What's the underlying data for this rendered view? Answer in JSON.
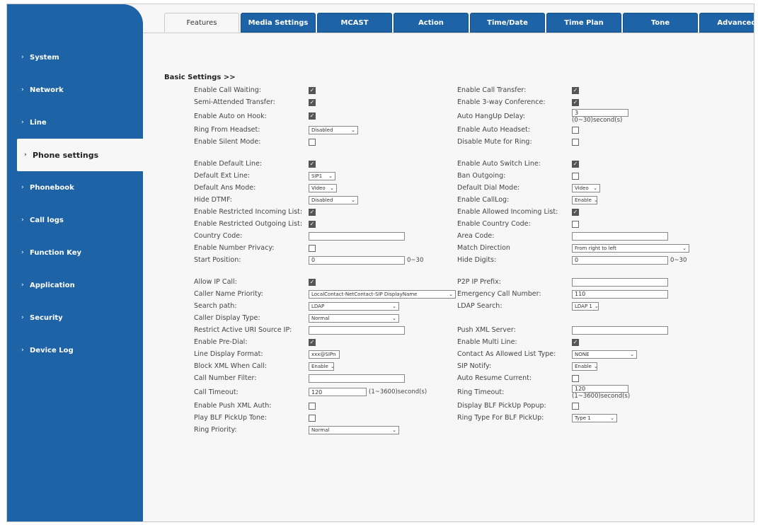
{
  "sidebar": {
    "items": [
      {
        "label": "System"
      },
      {
        "label": "Network"
      },
      {
        "label": "Line"
      },
      {
        "label": "Phone settings"
      },
      {
        "label": "Phonebook"
      },
      {
        "label": "Call logs"
      },
      {
        "label": "Function Key"
      },
      {
        "label": "Application"
      },
      {
        "label": "Security"
      },
      {
        "label": "Device Log"
      }
    ],
    "active_index": 3
  },
  "tabs": [
    "Features",
    "Media Settings",
    "MCAST",
    "Action",
    "Time/Date",
    "Time Plan",
    "Tone",
    "Advanced"
  ],
  "section": {
    "title": "Basic Settings >>"
  },
  "rows": [
    {
      "l": "Enable Call Waiting:",
      "r": "Enable Call Transfer:"
    },
    {
      "l": "Semi-Attended Transfer:",
      "r": "Enable 3-way Conference:"
    },
    {
      "l": "Enable Auto on Hook:",
      "r": "Auto HangUp Delay:",
      "r_val": "3",
      "r_unit": "(0~30)second(s)"
    },
    {
      "l": "Ring From Headset:",
      "l_sel": "Disabled",
      "r": "Enable Auto Headset:"
    },
    {
      "l": "Enable Silent Mode:",
      "r": "Disable Mute for Ring:"
    },
    {
      "l": "Enable Default Line:",
      "r": "Enable Auto Switch Line:"
    },
    {
      "l": "Default Ext Line:",
      "l_sel": "SIP1",
      "r": "Ban Outgoing:"
    },
    {
      "l": "Default Ans Mode:",
      "l_sel": "Video",
      "r": "Default Dial Mode:",
      "r_sel": "Video"
    },
    {
      "l": "Hide DTMF:",
      "l_sel": "Disabled",
      "r": "Enable CallLog:",
      "r_sel": "Enable"
    },
    {
      "l": "Enable Restricted Incoming List:",
      "r": "Enable Allowed Incoming List:"
    },
    {
      "l": "Enable Restricted Outgoing List:",
      "r": "Enable Country Code:"
    },
    {
      "l": "Country Code:",
      "r": "Area Code:"
    },
    {
      "l": "Enable Number Privacy:",
      "r": "Match Direction",
      "r_sel": "From right to left"
    },
    {
      "l": "Start Position:",
      "l_val": "0",
      "l_unit": "0~30",
      "r": "Hide Digits:",
      "r_val": "0",
      "r_unit": "0~30"
    },
    {
      "l": "Allow IP Call:",
      "r": "P2P IP Prefix:"
    },
    {
      "l": "Caller Name Priority:",
      "l_sel": "LocalContact-NetContact-SIP DisplayName",
      "r": "Emergency Call Number:",
      "r_val": "110"
    },
    {
      "l": "Search path:",
      "l_sel": "LDAP",
      "r": "LDAP Search:",
      "r_sel": "LDAP 1"
    },
    {
      "l": "Caller Display Type:",
      "l_sel": "Normal"
    },
    {
      "l": "Restrict Active URI Source IP:",
      "r": "Push XML Server:"
    },
    {
      "l": "Enable Pre-Dial:",
      "r": "Enable Multi Line:"
    },
    {
      "l": "Line Display Format:",
      "l_sel": "xxx@SIPn",
      "r": "Contact As Allowed List Type:",
      "r_sel": "NONE"
    },
    {
      "l": "Block XML When Call:",
      "l_sel": "Enable",
      "r": "SIP Notify:",
      "r_sel": "Enable"
    },
    {
      "l": "Call Number Filter:",
      "r": "Auto Resume Current:"
    },
    {
      "l": "Call Timeout:",
      "l_val": "120",
      "l_unit": "(1~3600)second(s)",
      "r": "Ring Timeout:",
      "r_val": "120",
      "r_unit": "(1~3600)second(s)"
    },
    {
      "l": "Enable Push XML Auth:",
      "r": "Display BLF PickUp Popup:"
    },
    {
      "l": "Play BLF PickUp Tone:",
      "r": "Ring Type For BLF PickUp:",
      "r_sel": "Type 1"
    },
    {
      "l": "Ring Priority:",
      "l_sel": "Normal"
    }
  ],
  "checkbox_states": {
    "enable_call_waiting": true,
    "enable_call_transfer": true,
    "semi_attended_transfer": true,
    "enable_3way_conference": true,
    "enable_auto_on_hook": true,
    "enable_auto_headset": false,
    "enable_silent_mode": false,
    "disable_mute_for_ring": false,
    "enable_default_line": true,
    "enable_auto_switch_line": true,
    "ban_outgoing": false,
    "enable_restricted_incoming_list": true,
    "enable_allowed_incoming_list": true,
    "enable_restricted_outgoing_list": true,
    "enable_country_code": false,
    "enable_number_privacy": false,
    "allow_ip_call": true,
    "enable_pre_dial": true,
    "enable_multi_line": true,
    "auto_resume_current": false,
    "enable_push_xml_auth": false,
    "display_blf_pickup_popup": false,
    "play_blf_pickup_tone": false
  },
  "colors": {
    "sidebar_bg": "#1e63a6",
    "tab_bg": "#1e63a6",
    "content_bg": "#f7f7f7"
  }
}
